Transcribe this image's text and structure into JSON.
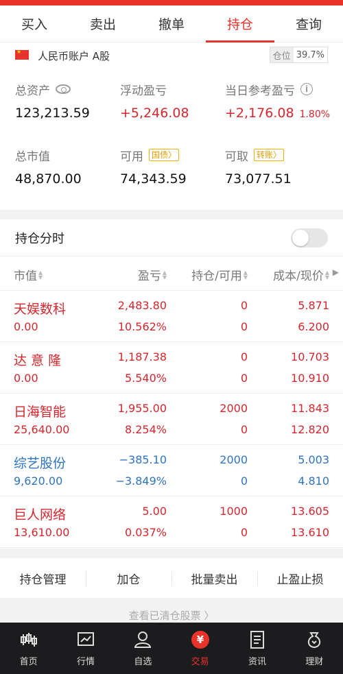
{
  "tabs": [
    "买入",
    "卖出",
    "撤单",
    "持仓",
    "查询"
  ],
  "account": {
    "label": "人民币账户 A股",
    "position_label": "仓位",
    "position_value": "39.7%"
  },
  "summary": {
    "total_assets_label": "总资产",
    "total_assets": "123,213.59",
    "floating_pl_label": "浮动盈亏",
    "floating_pl": "+5,246.08",
    "today_pl_label": "当日参考盈亏",
    "today_pl": "+2,176.08",
    "today_pl_pct": "1.80%",
    "market_value_label": "总市值",
    "market_value": "48,870.00",
    "available_label": "可用",
    "available_tag": "国债",
    "available": "74,343.59",
    "withdrawable_label": "可取",
    "withdrawable_tag": "转账",
    "withdrawable": "73,077.51"
  },
  "section": {
    "title": "持仓分时"
  },
  "columns": {
    "col1": "市值",
    "col2": "盈亏",
    "col3": "持仓/可用",
    "col4": "成本/现价"
  },
  "holdings": [
    {
      "name": "天娱数科",
      "market_value": "0.00",
      "pl": "2,483.80",
      "pl_pct": "10.562%",
      "qty": "0",
      "available": "0",
      "cost": "5.871",
      "price": "6.200",
      "color": "red"
    },
    {
      "name": "达 意 隆",
      "market_value": "0.00",
      "pl": "1,187.38",
      "pl_pct": "5.540%",
      "qty": "0",
      "available": "0",
      "cost": "10.703",
      "price": "10.910",
      "color": "red"
    },
    {
      "name": "日海智能",
      "market_value": "25,640.00",
      "pl": "1,955.00",
      "pl_pct": "8.254%",
      "qty": "2000",
      "available": "0",
      "cost": "11.843",
      "price": "12.820",
      "color": "red"
    },
    {
      "name": "综艺股份",
      "market_value": "9,620.00",
      "pl": "−385.10",
      "pl_pct": "−3.849%",
      "qty": "2000",
      "available": "0",
      "cost": "5.003",
      "price": "4.810",
      "color": "blue"
    },
    {
      "name": "巨人网络",
      "market_value": "13,610.00",
      "pl": "5.00",
      "pl_pct": "0.037%",
      "qty": "1000",
      "available": "0",
      "cost": "13.605",
      "price": "13.610",
      "color": "red"
    }
  ],
  "actions": [
    "持仓管理",
    "加仓",
    "批量卖出",
    "止盈止损"
  ],
  "cleared_link": "查看已清仓股票 〉",
  "nav": [
    {
      "label": "首页",
      "icon": "candlestick-icon"
    },
    {
      "label": "行情",
      "icon": "chart-icon"
    },
    {
      "label": "自选",
      "icon": "person-icon"
    },
    {
      "label": "交易",
      "icon": "yuan-icon"
    },
    {
      "label": "资讯",
      "icon": "document-icon"
    },
    {
      "label": "理财",
      "icon": "moneybag-icon"
    }
  ],
  "colors": {
    "accent": "#e8332b",
    "up": "#d7262d",
    "down": "#2f74c0"
  }
}
